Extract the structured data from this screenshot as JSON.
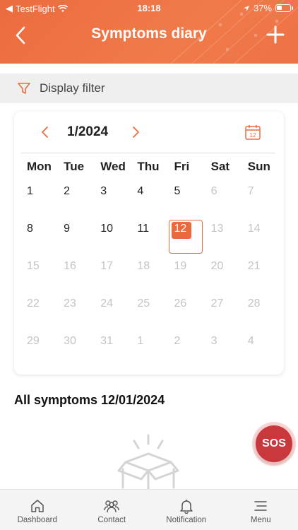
{
  "status_bar": {
    "carrier": "TestFlight",
    "time": "18:18",
    "battery": "37%"
  },
  "header": {
    "title": "Symptoms diary"
  },
  "filter": {
    "label": "Display filter"
  },
  "calendar": {
    "month_label": "1/2024",
    "weekdays": [
      "Mon",
      "Tue",
      "Wed",
      "Thu",
      "Fri",
      "Sat",
      "Sun"
    ],
    "weeks": [
      [
        "1",
        "2",
        "3",
        "4",
        "5",
        "6",
        "7"
      ],
      [
        "8",
        "9",
        "10",
        "11",
        "12",
        "13",
        "14"
      ],
      [
        "15",
        "16",
        "17",
        "18",
        "19",
        "20",
        "21"
      ],
      [
        "22",
        "23",
        "24",
        "25",
        "26",
        "27",
        "28"
      ],
      [
        "29",
        "30",
        "31",
        "1",
        "2",
        "3",
        "4"
      ]
    ],
    "selected_day": "12"
  },
  "section": {
    "title": "All symptoms 12/01/2024"
  },
  "sos": {
    "label": "SOS"
  },
  "tabs": [
    {
      "label": "Dashboard",
      "icon": "home-icon"
    },
    {
      "label": "Contact",
      "icon": "people-icon"
    },
    {
      "label": "Notification",
      "icon": "bell-icon"
    },
    {
      "label": "Menu",
      "icon": "menu-icon"
    }
  ],
  "colors": {
    "accent": "#ec6b3f",
    "sos": "#c8383c",
    "muted_day": "#c4c4c4"
  }
}
